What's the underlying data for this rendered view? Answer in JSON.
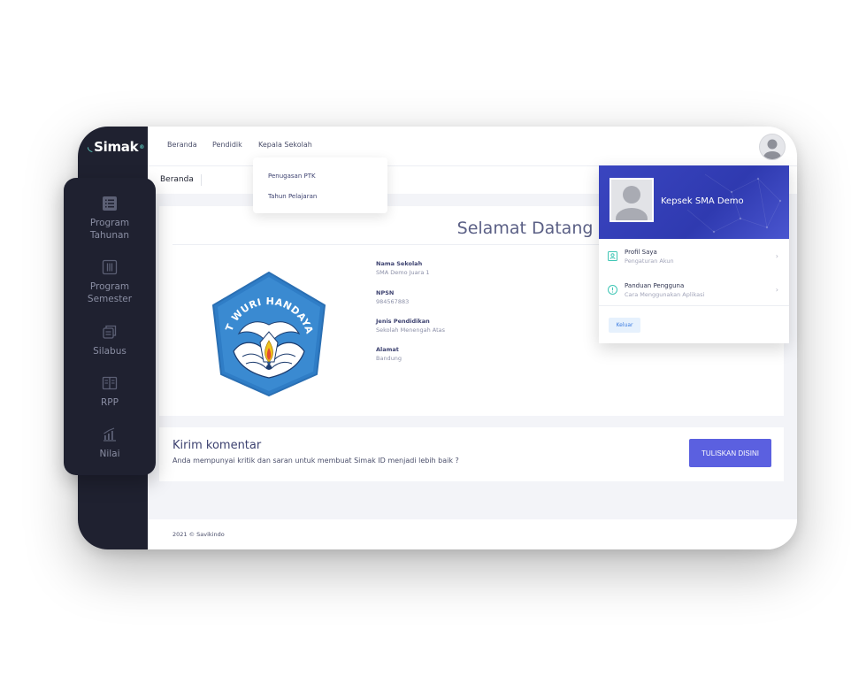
{
  "app": {
    "logo": "Simak",
    "logo_mark": "◟",
    "logo_sup": "®"
  },
  "topnav": {
    "items": [
      "Beranda",
      "Pendidik",
      "Kepala Sekolah"
    ]
  },
  "dropdown": {
    "items": [
      "Penugasan PTK",
      "Tahun Pelajaran"
    ]
  },
  "breadcrumb": {
    "current": "Beranda"
  },
  "welcome": {
    "title": "Selamat Datang di SIMAK"
  },
  "school": {
    "fields": [
      {
        "label": "Nama Sekolah",
        "value": "SMA Demo Juara 1"
      },
      {
        "label": "NPSN",
        "value": "984567883"
      },
      {
        "label": "Jenis Pendidikan",
        "value": "Sekolah Menengah Atas"
      },
      {
        "label": "Alamat",
        "value": "Bandung"
      }
    ],
    "emblem_text": "TUT WURI HANDAYANI"
  },
  "comment": {
    "title": "Kirim komentar",
    "subtitle": "Anda mempunyai kritik dan saran untuk membuat Simak ID menjadi lebih baik ?",
    "button": "TULISKAN DISINI"
  },
  "footer": {
    "text": "2021 © Savikindo"
  },
  "profile_menu": {
    "name": "Kepsek SMA Demo",
    "items": [
      {
        "title": "Profil Saya",
        "sub": "Pengaturan Akun",
        "icon": "user-card-icon"
      },
      {
        "title": "Panduan Pengguna",
        "sub": "Cara Menggunakan Aplikasi",
        "icon": "info-icon"
      }
    ],
    "chevron": "›",
    "logout": "Keluar"
  },
  "sidebar": {
    "items": [
      {
        "line1": "Program",
        "line2": "Tahunan",
        "icon": "list-icon"
      },
      {
        "line1": "Program",
        "line2": "Semester",
        "icon": "columns-icon"
      },
      {
        "line1": "Silabus",
        "line2": "",
        "icon": "copy-icon"
      },
      {
        "line1": "RPP",
        "line2": "",
        "icon": "book-icon"
      },
      {
        "line1": "Nilai",
        "line2": "",
        "icon": "chart-icon"
      }
    ]
  },
  "colors": {
    "accent": "#5b60e0",
    "sidebar": "#1f2130",
    "header_blue": "#3a45c0",
    "teal": "#3fc6b5"
  }
}
